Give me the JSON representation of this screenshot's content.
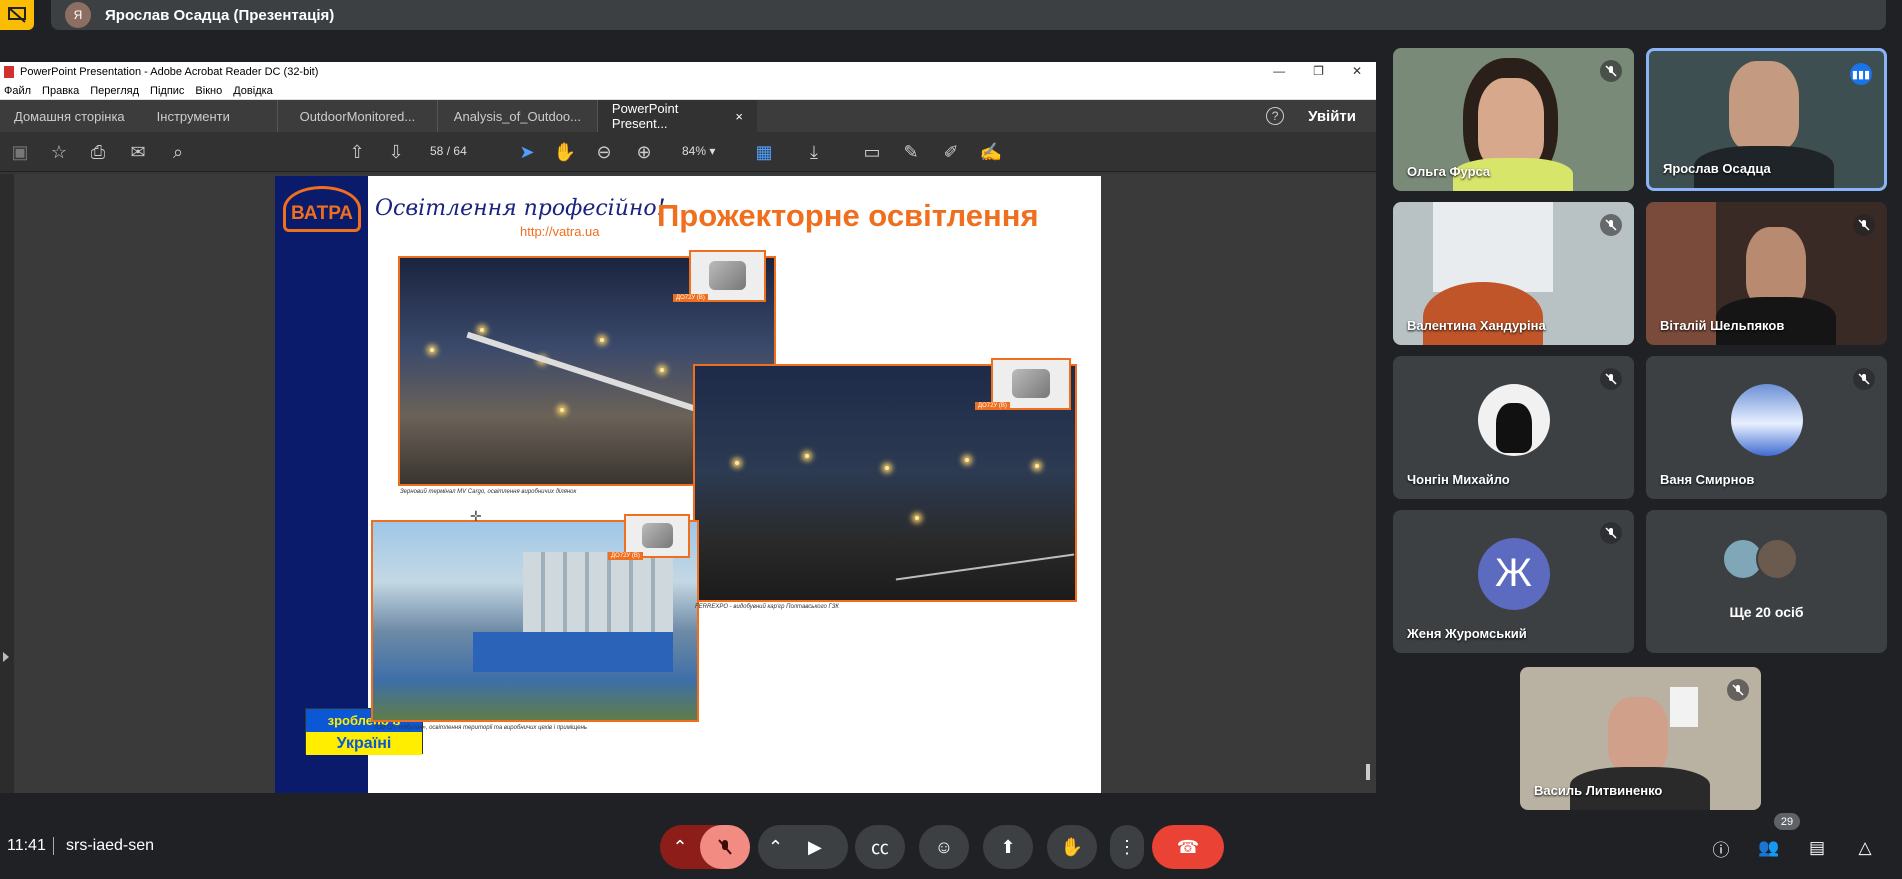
{
  "presenter": {
    "initial": "Я",
    "label": "Ярослав Осадца (Презентація)"
  },
  "acrobat": {
    "title": "PowerPoint Presentation - Adobe Acrobat Reader DC (32-bit)",
    "menu": [
      "Файл",
      "Правка",
      "Перегляд",
      "Підпис",
      "Вікно",
      "Довідка"
    ],
    "home_tab": "Домашня сторінка",
    "tools_tab": "Інструменти",
    "doc_tabs": [
      "OutdoorMonitored...",
      "Analysis_of_Outdoo...",
      "PowerPoint Present..."
    ],
    "close_tab": "×",
    "help": "?",
    "login": "Увійти",
    "page_current": "58",
    "page_sep": "/",
    "page_total": "64",
    "zoom": "84%"
  },
  "slide": {
    "logo": "ВАТРА",
    "slogan": "Освітлення професійно!",
    "url": "http://vatra.ua",
    "title": "Прожекторне освітлення",
    "tag1": "ДО72У (В)",
    "tag2": "ДО72У (В)",
    "tag3": "ДО72У (В)",
    "caption1": "Зерновий термінал MV Cargo, освітлення виробничих ділянок",
    "caption2": "FERREXPO - видобувний кар'єр Полтавського ГЗК",
    "caption3": "ТОВ СП «Нібулон», освітлення території та виробничих цехів і приміщень",
    "made_line1": "зроблено в",
    "made_line2": "Україні"
  },
  "participants": [
    {
      "name": "Ольга Фурса"
    },
    {
      "name": "Ярослав Осадца"
    },
    {
      "name": "Валентина Хандуріна"
    },
    {
      "name": "Віталій Шельпяков"
    },
    {
      "name": "Чонгін Михайло"
    },
    {
      "name": "Ваня Смирнов"
    },
    {
      "name": "Женя Журомський",
      "initial": "Ж"
    },
    {
      "name": "Ще 20 осіб"
    },
    {
      "name": "Василь Литвиненко"
    }
  ],
  "bottom": {
    "time": "11:41",
    "code": "srs-iaed-sen",
    "people_count": "29"
  },
  "colors": {
    "accent": "#ef6f1e",
    "end_call": "#ea4335",
    "mic_off": "#f28b82",
    "speaking": "#1a73e8"
  }
}
